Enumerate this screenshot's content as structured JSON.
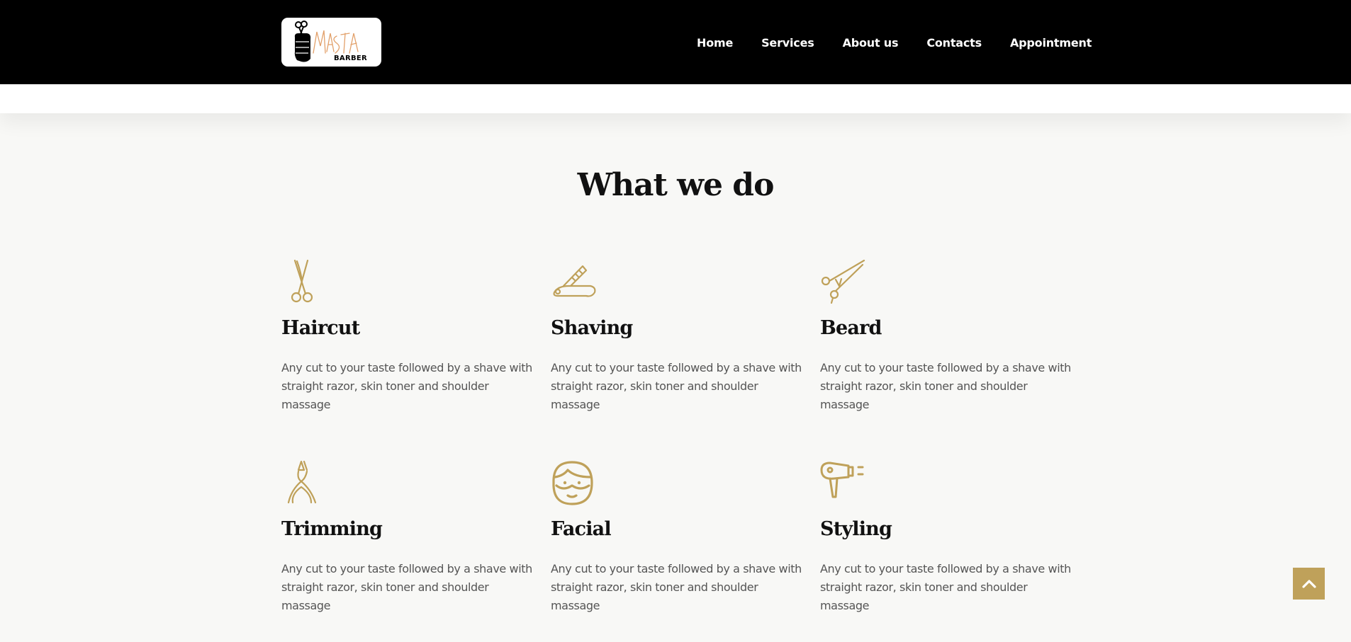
{
  "brand": {
    "logo_script": "MASTA",
    "logo_word": "BARBER"
  },
  "nav": {
    "items": [
      {
        "label": "Home"
      },
      {
        "label": "Services"
      },
      {
        "label": "About us"
      },
      {
        "label": "Contacts"
      },
      {
        "label": "Appointment"
      }
    ]
  },
  "main": {
    "title": "What we do",
    "services": [
      {
        "name": "Haircut",
        "icon": "scissors-icon",
        "description": "Any cut to your taste followed by a shave with straight razor, skin toner and shoulder massage"
      },
      {
        "name": "Shaving",
        "icon": "straight-razor-icon",
        "description": "Any cut to your taste followed by a shave with straight razor, skin toner and shoulder massage"
      },
      {
        "name": "Beard",
        "icon": "barber-scissors-icon",
        "description": "Any cut to your taste followed by a shave with straight razor, skin toner and shoulder massage"
      },
      {
        "name": "Trimming",
        "icon": "nail-clipper-icon",
        "description": "Any cut to your taste followed by a shave with straight razor, skin toner and shoulder massage"
      },
      {
        "name": "Facial",
        "icon": "face-mask-icon",
        "description": "Any cut to your taste followed by a shave with straight razor, skin toner and shoulder massage"
      },
      {
        "name": "Styling",
        "icon": "hair-dryer-icon",
        "description": "Any cut to your taste followed by a shave with straight razor, skin toner and shoulder massage"
      }
    ]
  },
  "scroll_top": {
    "icon": "chevron-up-icon"
  },
  "colors": {
    "accent": "#bfa15a",
    "header_bg": "#000000",
    "page_bg": "#f8f8f6",
    "heading": "#111111",
    "body_text": "#555555"
  }
}
